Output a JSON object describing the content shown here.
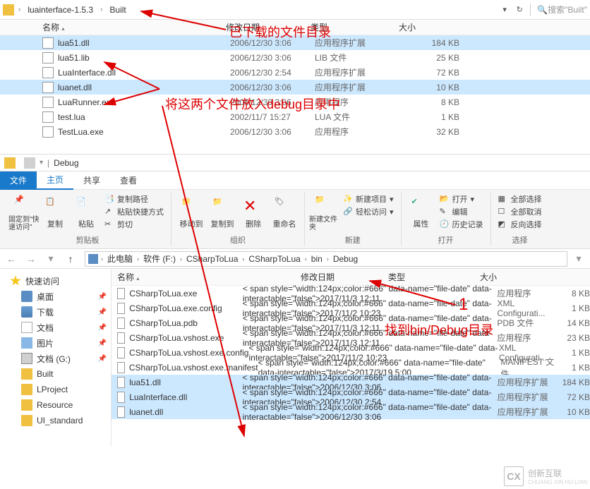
{
  "top": {
    "breadcrumb": [
      "luainterface-1.5.3",
      "Built"
    ],
    "search_placeholder": "搜索\"Built\"",
    "columns": {
      "name": "名称",
      "date": "修改日期",
      "type": "类型",
      "size": "大小"
    },
    "files": [
      {
        "name": "lua51.dll",
        "date": "2006/12/30 3:06",
        "type": "应用程序扩展",
        "size": "184 KB",
        "selected": true
      },
      {
        "name": "lua51.lib",
        "date": "2006/12/30 3:06",
        "type": "LIB 文件",
        "size": "25 KB",
        "selected": false
      },
      {
        "name": "LuaInterface.dll",
        "date": "2006/12/30 2:54",
        "type": "应用程序扩展",
        "size": "72 KB",
        "selected": false
      },
      {
        "name": "luanet.dll",
        "date": "2006/12/30 3:06",
        "type": "应用程序扩展",
        "size": "10 KB",
        "selected": true
      },
      {
        "name": "LuaRunner.exe",
        "date": "2006/12/30 3:06",
        "type": "应用程序",
        "size": "8 KB",
        "selected": false
      },
      {
        "name": "test.lua",
        "date": "2002/11/7 15:27",
        "type": "LUA 文件",
        "size": "1 KB",
        "selected": false
      },
      {
        "name": "TestLua.exe",
        "date": "2006/12/30 3:06",
        "type": "应用程序",
        "size": "32 KB",
        "selected": false
      }
    ]
  },
  "bottom": {
    "tab": "Debug",
    "menu": {
      "file": "文件",
      "home": "主页",
      "share": "共享",
      "view": "查看"
    },
    "ribbon": {
      "pin": "固定到\"快速访问\"",
      "copy": "复制",
      "paste": "粘贴",
      "copy_path": "复制路径",
      "paste_shortcut": "粘贴快捷方式",
      "cut": "剪切",
      "clipboard": "剪贴板",
      "move_to": "移动到",
      "copy_to": "复制到",
      "delete": "删除",
      "rename": "重命名",
      "organize": "组织",
      "new_folder": "新建文件夹",
      "new_item": "新建项目",
      "easy_access": "轻松访问",
      "new": "新建",
      "properties": "属性",
      "open": "打开",
      "edit": "编辑",
      "history": "历史记录",
      "open_group": "打开",
      "select_all": "全部选择",
      "select_none": "全部取消",
      "invert": "反向选择",
      "select": "选择"
    },
    "nav": [
      "此电脑",
      "软件 (F:)",
      "CSharpToLua",
      "CSharpToLua",
      "bin",
      "Debug"
    ],
    "sidebar": [
      {
        "label": "快速访问",
        "icon": "star",
        "indent": false,
        "pin": false
      },
      {
        "label": "桌面",
        "icon": "monitor",
        "indent": true,
        "pin": true
      },
      {
        "label": "下载",
        "icon": "dl",
        "indent": true,
        "pin": true
      },
      {
        "label": "文档",
        "icon": "doc",
        "indent": true,
        "pin": true
      },
      {
        "label": "图片",
        "icon": "pic",
        "indent": true,
        "pin": true
      },
      {
        "label": "文档 (G:)",
        "icon": "drive",
        "indent": true,
        "pin": true
      },
      {
        "label": "Built",
        "icon": "folder",
        "indent": true,
        "pin": false
      },
      {
        "label": "LProject",
        "icon": "folder",
        "indent": true,
        "pin": false
      },
      {
        "label": "Resource",
        "icon": "folder",
        "indent": true,
        "pin": false
      },
      {
        "label": "UI_standard",
        "icon": "folder",
        "indent": true,
        "pin": false
      }
    ],
    "columns": {
      "name": "名称",
      "date": "修改日期",
      "type": "类型",
      "size": "大小"
    },
    "files": [
      {
        "name": "CSharpToLua.exe",
        "date": "2017/11/3 12:11",
        "type": "应用程序",
        "size": "8 KB",
        "selected": false
      },
      {
        "name": "CSharpToLua.exe.config",
        "date": "2017/11/2 10:23",
        "type": "XML Configurati...",
        "size": "1 KB",
        "selected": false
      },
      {
        "name": "CSharpToLua.pdb",
        "date": "2017/11/3 12:11",
        "type": "PDB 文件",
        "size": "14 KB",
        "selected": false
      },
      {
        "name": "CSharpToLua.vshost.exe",
        "date": "2017/11/3 12:11",
        "type": "应用程序",
        "size": "23 KB",
        "selected": false
      },
      {
        "name": "CSharpToLua.vshost.exe.config",
        "date": "2017/11/2 10:23",
        "type": "XML Configurati...",
        "size": "1 KB",
        "selected": false
      },
      {
        "name": "CSharpToLua.vshost.exe.manifest",
        "date": "2017/3/19 5:00",
        "type": "MANIFEST 文件",
        "size": "1 KB",
        "selected": false
      },
      {
        "name": "lua51.dll",
        "date": "2006/12/30 3:06",
        "type": "应用程序扩展",
        "size": "184 KB",
        "selected": true
      },
      {
        "name": "LuaInterface.dll",
        "date": "2006/12/30 2:54",
        "type": "应用程序扩展",
        "size": "72 KB",
        "selected": true
      },
      {
        "name": "luanet.dll",
        "date": "2006/12/30 3:06",
        "type": "应用程序扩展",
        "size": "10 KB",
        "selected": true
      }
    ]
  },
  "annotations": {
    "a1": "已下载的文件目录",
    "a2": "将这两个文件放入debug目录中",
    "a3": "1",
    "a4": "找到bin/Debug目录"
  },
  "watermark": {
    "brand": "创新互联",
    "sub": "CHUANG XIN HU LIAN",
    "logo": "CX"
  }
}
